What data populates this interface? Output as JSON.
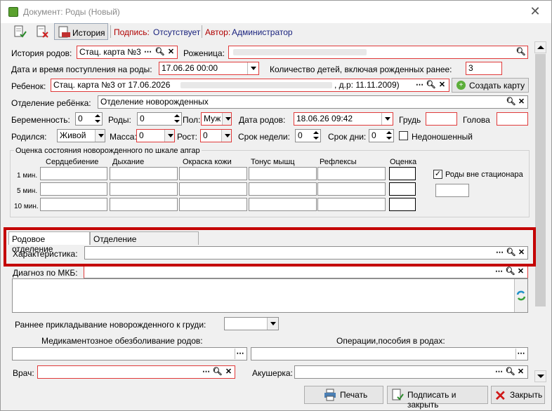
{
  "window": {
    "title": "Документ: Роды (Новый)"
  },
  "toolbar": {
    "history": "История",
    "signature_label": "Подпись:",
    "signature_value": "Отсутствует",
    "author_label": "Автор:",
    "author_value": "Администратор"
  },
  "form": {
    "history_label": "История родов:",
    "history_value": "Стац. карта №3",
    "mother_label": "Роженица:",
    "admission_label": "Дата и время поступления на роды:",
    "admission_value": "17.06.26 00:00",
    "children_count_label": "Количество детей, включая рожденных ранее:",
    "children_count_value": "3",
    "child_label": "Ребенок:",
    "child_value_start": "Стац. карта №3 от 17.06.2026",
    "child_value_end": ", д.р: 11.11.2009)",
    "create_card_button": "Создать карту",
    "dept_label": "Отделение ребёнка:",
    "dept_value": "Отделение новорожденных",
    "pregnancy_label": "Беременность:",
    "pregnancy_value": "0",
    "births_label": "Роды:",
    "births_value": "0",
    "sex_label": "Пол:",
    "sex_value": "Муж",
    "birth_date_label": "Дата родов:",
    "birth_date_value": "18.06.26 09:42",
    "chest_label": "Грудь",
    "head_label": "Голова",
    "born_label": "Родился:",
    "born_value": "Живой",
    "mass_label": "Масса:",
    "mass_value": "0",
    "height_label": "Рост:",
    "height_value": "0",
    "weeks_label": "Срок недели:",
    "weeks_value": "0",
    "days_label": "Срок дни:",
    "days_value": "0",
    "premature_label": "Недоношенный"
  },
  "apgar": {
    "title": "Оценка состояния новорожденного по шкале апгар",
    "columns": [
      "Сердцебиение",
      "Дыхание",
      "Окраска кожи",
      "Тонус мышц",
      "Рефлексы",
      "Оценка"
    ],
    "rows": [
      "1 мин.",
      "5 мин.",
      "10 мин."
    ],
    "outside_label": "Роды вне стационара"
  },
  "tabs": [
    "Родовое отделение",
    "Отделение новорожденных"
  ],
  "lower": {
    "characteristic_label": "Характеристика:",
    "diagnosis_label": "Диагноз по МКБ:",
    "early_label": "Раннее прикладывание новорожденного к груди:",
    "anesthesia_label": "Медикаментозное обезболивание родов:",
    "operations_label": "Операции,пособия в родах:",
    "doctor_label": "Врач:",
    "midwife_label": "Акушерка:"
  },
  "buttons": {
    "print": "Печать",
    "sign_close": "Подписать и закрыть",
    "close": "Закрыть"
  },
  "colors": {
    "highlight": "#c40000",
    "required_border": "#e03a3a",
    "link_blue": "#1a237e"
  }
}
